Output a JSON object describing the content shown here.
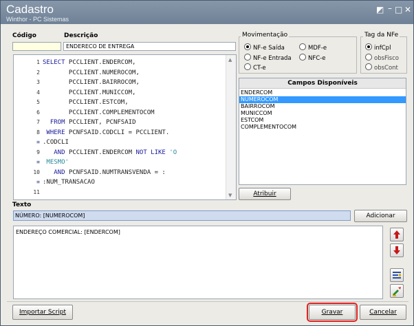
{
  "window": {
    "title": "Cadastro",
    "subtitle": "Winthor - PC Sistemas",
    "controls": [
      "restore-icon",
      "minimize-icon",
      "maximize-icon",
      "close-icon"
    ]
  },
  "form": {
    "codigo_label": "Código",
    "codigo_value": "",
    "descricao_label": "Descrição",
    "descricao_value": "ENDERECO DE ENTREGA"
  },
  "script_lines": [
    {
      "num": "1",
      "text": "SELECT PCCLIENT.ENDERCOM,"
    },
    {
      "num": "2",
      "text": "       PCCLIENT.NUMEROCOM,"
    },
    {
      "num": "3",
      "text": "       PCCLIENT.BAIRROCOM,"
    },
    {
      "num": "4",
      "text": "       PCCLIENT.MUNICCOM,"
    },
    {
      "num": "5",
      "text": "       PCCLIENT.ESTCOM,"
    },
    {
      "num": "6",
      "text": "       PCCLIENT.COMPLEMENTOCOM"
    },
    {
      "num": "7",
      "text": "  FROM PCCLIENT, PCNFSAID"
    },
    {
      "num": "8",
      "text": " WHERE PCNFSAID.CODCLI = PCCLIENT."
    },
    {
      "num": "≡",
      "text": ".CODCLI"
    },
    {
      "num": "9",
      "text": "   AND PCCLIENT.ENDERCOM NOT LIKE 'O"
    },
    {
      "num": "≡",
      "text": " MESMO'"
    },
    {
      "num": "10",
      "text": "   AND PCNFSAID.NUMTRANSVENDA = :"
    },
    {
      "num": "≡",
      "text": ":NUM_TRANSACAO"
    },
    {
      "num": "11",
      "text": ""
    }
  ],
  "movimentacao": {
    "title": "Movimentação",
    "options": [
      {
        "label": "NF-e Saída",
        "selected": true
      },
      {
        "label": "MDF-e",
        "selected": false
      },
      {
        "label": "NF-e Entrada",
        "selected": false
      },
      {
        "label": "NFC-e",
        "selected": false
      },
      {
        "label": "CT-e",
        "selected": false
      }
    ]
  },
  "tag_nfe": {
    "title": "Tag da NFe",
    "options": [
      {
        "label": "infCpl",
        "selected": true
      },
      {
        "label": "obsFisco",
        "selected": false
      },
      {
        "label": "obsCont",
        "selected": false
      }
    ]
  },
  "campos": {
    "title": "Campos Disponíveis",
    "items": [
      "ENDERCOM",
      "NUMEROCOM",
      "BAIRROCOM",
      "MUNICCOM",
      "ESTCOM",
      "COMPLEMENTOCOM"
    ],
    "selected": "NUMEROCOM",
    "atribuir_label": "Atribuir"
  },
  "texto": {
    "label": "Texto",
    "value": "NÚMERO: [NUMEROCOM]",
    "adicionar_label": "Adicionar",
    "memo_value": "ENDEREÇO COMERCIAL: [ENDERCOM]"
  },
  "side_buttons": [
    "arrow-up-icon",
    "arrow-down-icon",
    "clear-field-icon",
    "edit-brush-icon"
  ],
  "footer": {
    "importar_label": "Importar Script",
    "gravar_label": "Gravar",
    "cancelar_label": "Cancelar"
  },
  "colors": {
    "title_bar": "#7b8ca1",
    "selection": "#3399ff",
    "gravar_highlight": "#e02020",
    "arrow_red": "#c81818"
  }
}
